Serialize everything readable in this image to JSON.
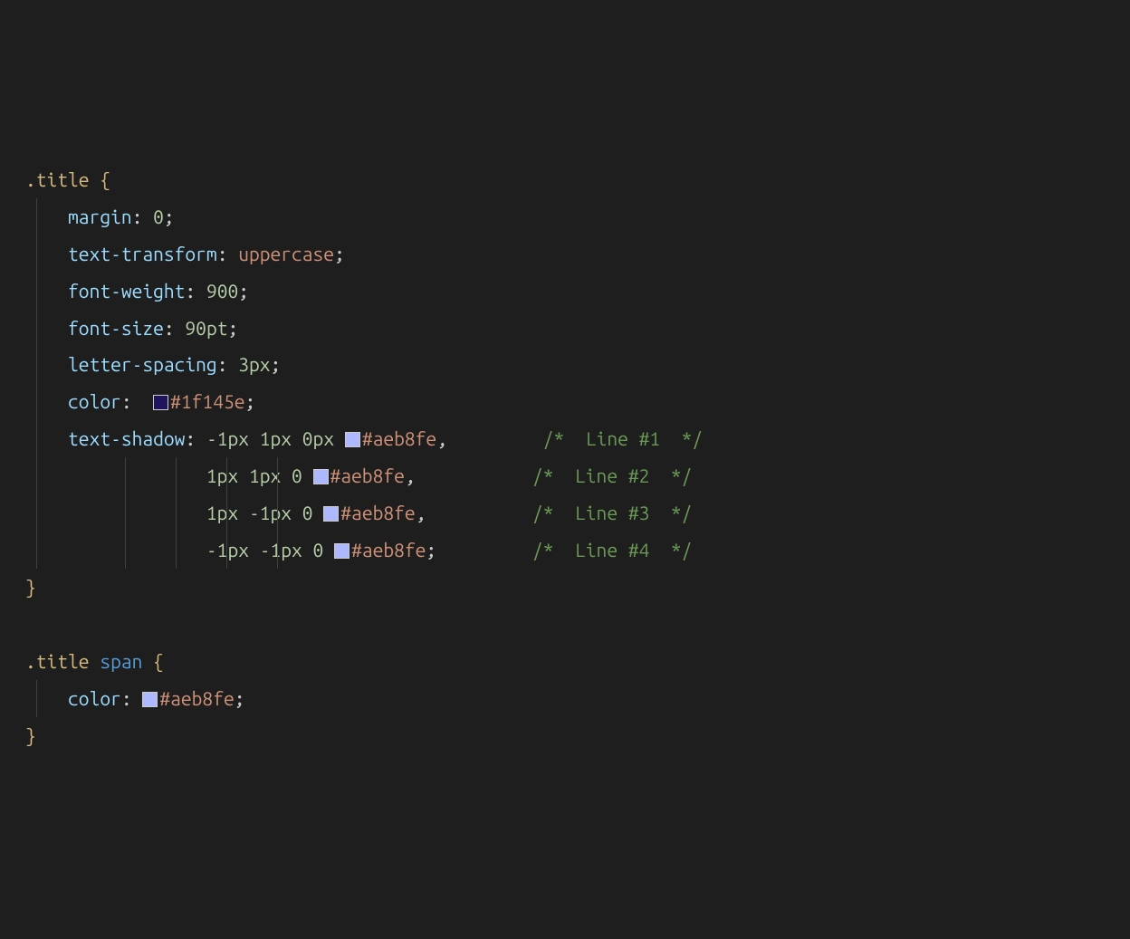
{
  "rules": [
    {
      "selector": ".title",
      "declarations": [
        {
          "property": "margin",
          "value": "0",
          "value_type": "number"
        },
        {
          "property": "text-transform",
          "value": "uppercase",
          "value_type": "keyword"
        },
        {
          "property": "font-weight",
          "value": "900",
          "value_type": "number"
        },
        {
          "property": "font-size",
          "value": "90pt",
          "value_type": "number"
        },
        {
          "property": "letter-spacing",
          "value": "3px",
          "value_type": "number"
        },
        {
          "property": "color",
          "value_hex": "#1f145e",
          "swatch": "#1f145e",
          "value_type": "color"
        },
        {
          "property": "text-shadow",
          "value_type": "shadow-multi",
          "shadows": [
            {
              "offsets": "-1px 1px 0px",
              "hex": "#aeb8fe",
              "swatch": "#aeb8fe",
              "terminator": ",",
              "comment": "/*  Line #1  */"
            },
            {
              "offsets": "1px 1px 0",
              "hex": "#aeb8fe",
              "swatch": "#aeb8fe",
              "terminator": ",",
              "comment": "/*  Line #2  */"
            },
            {
              "offsets": "1px -1px 0",
              "hex": "#aeb8fe",
              "swatch": "#aeb8fe",
              "terminator": ",",
              "comment": "/*  Line #3  */"
            },
            {
              "offsets": "-1px -1px 0",
              "hex": "#aeb8fe",
              "swatch": "#aeb8fe",
              "terminator": ";",
              "comment": "/*  Line #4  */"
            }
          ]
        }
      ]
    },
    {
      "selector_class": ".title",
      "selector_tag": "span",
      "declarations": [
        {
          "property": "color",
          "value_hex": "#aeb8fe",
          "swatch": "#aeb8fe",
          "value_type": "color"
        }
      ]
    }
  ],
  "indent": "    ",
  "continuation_indent": "                 "
}
